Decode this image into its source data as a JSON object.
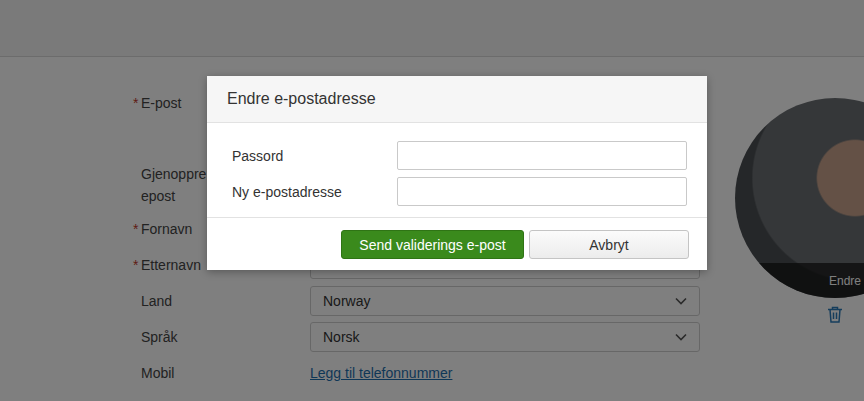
{
  "page": {
    "form": [
      {
        "label": "E-post",
        "label_2": "",
        "required": true,
        "kind": "text",
        "value": ""
      },
      {
        "label": "Gjenoppre",
        "label_2": "epost",
        "required": false,
        "kind": "text",
        "value": ""
      },
      {
        "label": "Fornavn",
        "label_2": "",
        "required": true,
        "kind": "text",
        "value": ""
      },
      {
        "label": "Etternavn",
        "label_2": "",
        "required": true,
        "kind": "text",
        "value": ""
      },
      {
        "label": "Land",
        "label_2": "",
        "required": false,
        "kind": "select",
        "value": "Norway"
      },
      {
        "label": "Språk",
        "label_2": "",
        "required": false,
        "kind": "select",
        "value": "Norsk"
      },
      {
        "label": "Mobil",
        "label_2": "",
        "required": false,
        "kind": "link",
        "value": "Legg til telefonnummer"
      }
    ],
    "required_mark": "*",
    "avatar": {
      "edit_label": "Endre"
    }
  },
  "dialog": {
    "title": "Endre e-postadresse",
    "fields": [
      {
        "label": "Passord",
        "value": ""
      },
      {
        "label": "Ny e-postadresse",
        "value": ""
      }
    ],
    "buttons": [
      {
        "label": "Send validerings e-post",
        "kind": "primary"
      },
      {
        "label": "Avbryt",
        "kind": "secondary"
      }
    ]
  }
}
